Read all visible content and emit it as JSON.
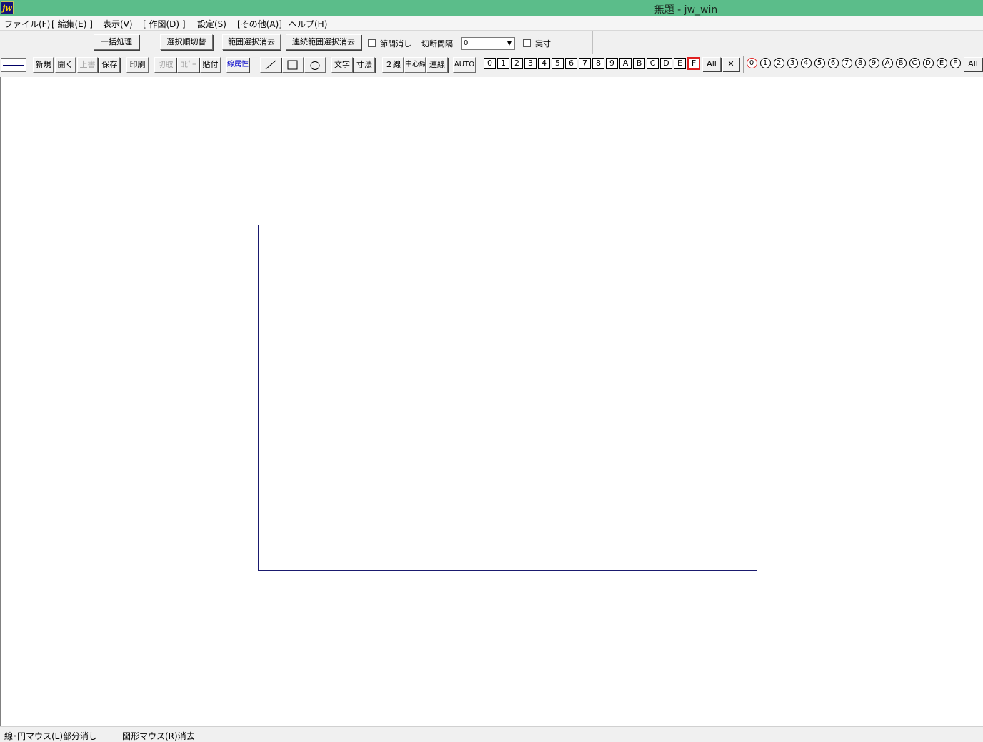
{
  "window": {
    "title": "無題 - jw_win",
    "icon": "jw-app-icon",
    "icon_text": "jw"
  },
  "menubar": [
    "ファイル(F)",
    "[ 編集(E) ]",
    "表示(V)",
    "[ 作図(D) ]",
    "設定(S)",
    "[その他(A)]",
    "ヘルプ(H)"
  ],
  "toolbar1": {
    "batch": "一括処理",
    "select_order": "選択順切替",
    "range_delete": "範囲選択消去",
    "continuous_range_delete": "連続範囲選択消去",
    "gap_delete_label": "節間消し",
    "gap_delete_checked": false,
    "cut_interval_label": "切断間隔",
    "cut_interval_value": "0",
    "actual_label": "実寸",
    "actual_checked": false
  },
  "toolbar2": {
    "new": "新規",
    "open": "開く",
    "overwrite": "上書",
    "save": "保存",
    "print": "印刷",
    "cut": "切取",
    "copy": "ｺﾋﾟｰ",
    "paste": "貼付",
    "line_attr": "線属性",
    "line_icon": "line-icon",
    "rect_icon": "rectangle-icon",
    "circle_icon": "circle-icon",
    "text": "文字",
    "dimension": "寸法",
    "double_line": "２線",
    "center_line": "中心線",
    "continuous_line": "連線",
    "auto": "AUTO"
  },
  "layers": {
    "items": [
      "0",
      "1",
      "2",
      "3",
      "4",
      "5",
      "6",
      "7",
      "8",
      "9",
      "A",
      "B",
      "C",
      "D",
      "E",
      "F"
    ],
    "active": "F",
    "all": "All",
    "close": "✕"
  },
  "layer_groups": {
    "items": [
      "0",
      "1",
      "2",
      "3",
      "4",
      "5",
      "6",
      "7",
      "8",
      "9",
      "A",
      "B",
      "C",
      "D",
      "E",
      "F"
    ],
    "active": "0",
    "all": "All"
  },
  "status": {
    "left": "線･円マウス(L)部分消し",
    "right": "図形マウス(R)消去"
  },
  "colors": {
    "titlebar": "#5bbd8a",
    "paper_border": "#1a1a6e",
    "active_layer": "#e02020"
  }
}
